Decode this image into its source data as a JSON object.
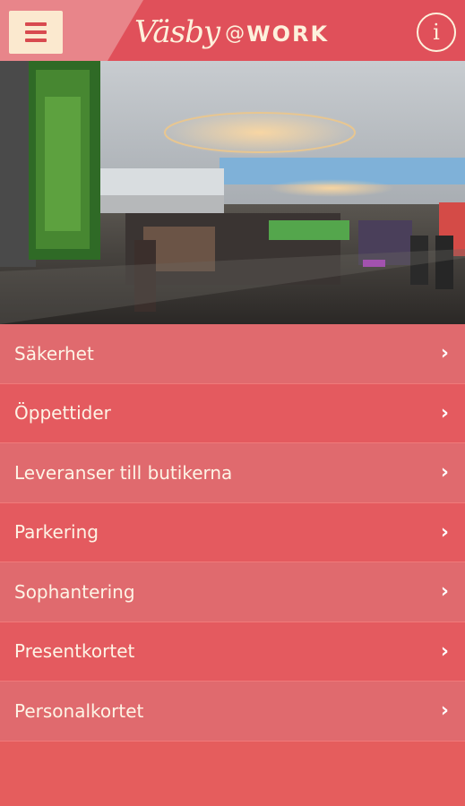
{
  "header": {
    "logo_script": "Väsby",
    "logo_at": "@",
    "logo_work": "WORK",
    "menu_icon": "hamburger-icon",
    "info_icon": "info-icon",
    "info_glyph": "i"
  },
  "menu": {
    "items": [
      {
        "label": "Säkerhet"
      },
      {
        "label": "Öppettider"
      },
      {
        "label": "Leveranser till butikerna"
      },
      {
        "label": "Parkering"
      },
      {
        "label": "Sophantering"
      },
      {
        "label": "Presentkortet"
      },
      {
        "label": "Personalkortet"
      }
    ],
    "chevron": "›"
  },
  "colors": {
    "header": "#e0505a",
    "row_light": "#e06a6e",
    "row_dark": "#e45a5f",
    "text": "#fdf4e6"
  }
}
